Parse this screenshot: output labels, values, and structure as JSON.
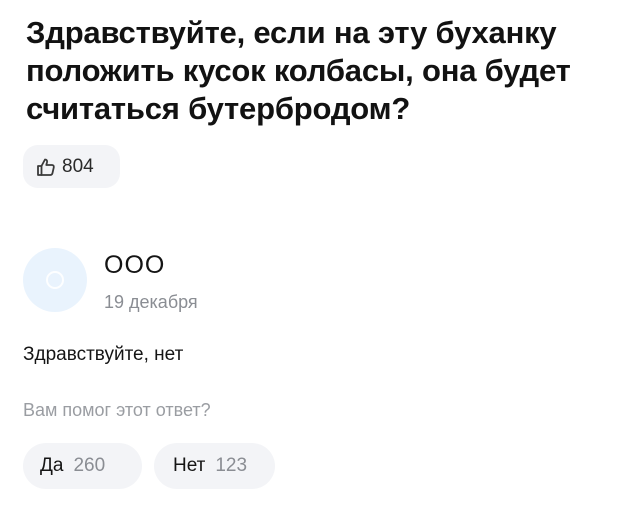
{
  "question": {
    "title": "Здравствуйте, если на эту буханку положить кусок колбасы, она будет считаться бутербродом?",
    "like": {
      "icon": "thumbs-up-icon",
      "count": "804"
    }
  },
  "answer": {
    "author": "ООО",
    "date": "19 декабря",
    "text": "Здравствуйте, нет",
    "avatar_color": "#e9f3fd"
  },
  "feedback": {
    "prompt": "Вам помог этот ответ?",
    "yes_label": "Да",
    "yes_count": "260",
    "no_label": "Нет",
    "no_count": "123"
  },
  "colors": {
    "button_bg": "#f3f4f7",
    "muted_text": "#8a8d93",
    "like_icon": "#3a3a3a"
  }
}
